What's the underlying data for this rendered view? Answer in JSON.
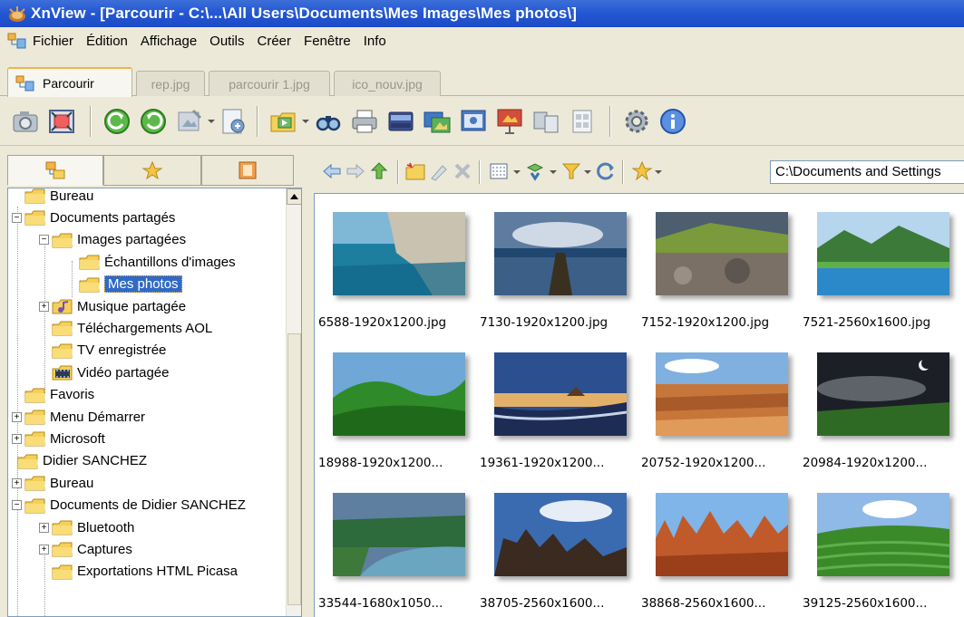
{
  "window": {
    "title": "XnView - [Parcourir - C:\\...\\All Users\\Documents\\Mes Images\\Mes photos\\]"
  },
  "menu": {
    "items": [
      "Fichier",
      "Édition",
      "Affichage",
      "Outils",
      "Créer",
      "Fenêtre",
      "Info"
    ]
  },
  "tabs": [
    {
      "label": "Parcourir",
      "active": true
    },
    {
      "label": "rep.jpg",
      "active": false
    },
    {
      "label": "parcourir 1.jpg",
      "active": false
    },
    {
      "label": "ico_nouv.jpg",
      "active": false
    }
  ],
  "toolbar": {
    "icons": [
      "camera-icon",
      "fullscreen-icon",
      "rotate-left-icon",
      "rotate-right-icon",
      "edit-image-icon",
      "convert-icon",
      "slideshow-folder-icon",
      "find-icon",
      "print-icon",
      "scanner-icon",
      "capture-icon",
      "screenshot-icon",
      "presentation-icon",
      "compare-icon",
      "contact-sheet-icon",
      "settings-icon",
      "info-icon"
    ]
  },
  "left_tabs": [
    "folders-tab",
    "favorites-tab",
    "categories-tab"
  ],
  "tree": [
    {
      "label": "Bureau",
      "level": 1,
      "expander": ""
    },
    {
      "label": "Documents partagés",
      "level": 1,
      "expander": "−"
    },
    {
      "label": "Images partagées",
      "level": 2,
      "expander": "−"
    },
    {
      "label": "Échantillons d'images",
      "level": 3,
      "expander": ""
    },
    {
      "label": "Mes photos",
      "level": 3,
      "expander": "",
      "selected": true
    },
    {
      "label": "Musique partagée",
      "level": 2,
      "expander": "+"
    },
    {
      "label": "Téléchargements AOL",
      "level": 2,
      "expander": ""
    },
    {
      "label": "TV enregistrée",
      "level": 2,
      "expander": ""
    },
    {
      "label": "Vidéo partagée",
      "level": 2,
      "expander": ""
    },
    {
      "label": "Favoris",
      "level": 1,
      "expander": ""
    },
    {
      "label": "Menu Démarrer",
      "level": 1,
      "expander": "+"
    },
    {
      "label": "Microsoft",
      "level": 1,
      "expander": "+"
    },
    {
      "label": "Didier SANCHEZ",
      "level": 0,
      "expander": ""
    },
    {
      "label": "Bureau",
      "level": 1,
      "expander": "+"
    },
    {
      "label": "Documents de Didier SANCHEZ",
      "level": 1,
      "expander": "−"
    },
    {
      "label": "Bluetooth",
      "level": 2,
      "expander": "+"
    },
    {
      "label": "Captures",
      "level": 2,
      "expander": "+"
    },
    {
      "label": "Exportations HTML Picasa",
      "level": 2,
      "expander": ""
    }
  ],
  "address": {
    "value": "C:\\Documents and Settings"
  },
  "thumbnails": [
    {
      "caption": "6588-1920x1200.jpg",
      "scene": "coast-cliff"
    },
    {
      "caption": "7130-1920x1200.jpg",
      "scene": "pier"
    },
    {
      "caption": "7152-1920x1200.jpg",
      "scene": "rocky-shore"
    },
    {
      "caption": "7521-2560x1600.jpg",
      "scene": "mountain-lake"
    },
    {
      "caption": "18988-1920x1200...",
      "scene": "green-hills"
    },
    {
      "caption": "19361-1920x1200...",
      "scene": "desert-sunset"
    },
    {
      "caption": "20752-1920x1200...",
      "scene": "canyon"
    },
    {
      "caption": "20984-1920x1200...",
      "scene": "moon-night"
    },
    {
      "caption": "33544-1680x1050...",
      "scene": "river"
    },
    {
      "caption": "38705-2560x1600...",
      "scene": "rock-towers"
    },
    {
      "caption": "38868-2560x1600...",
      "scene": "hoodoos"
    },
    {
      "caption": "39125-2560x1600...",
      "scene": "rice-fields"
    }
  ]
}
